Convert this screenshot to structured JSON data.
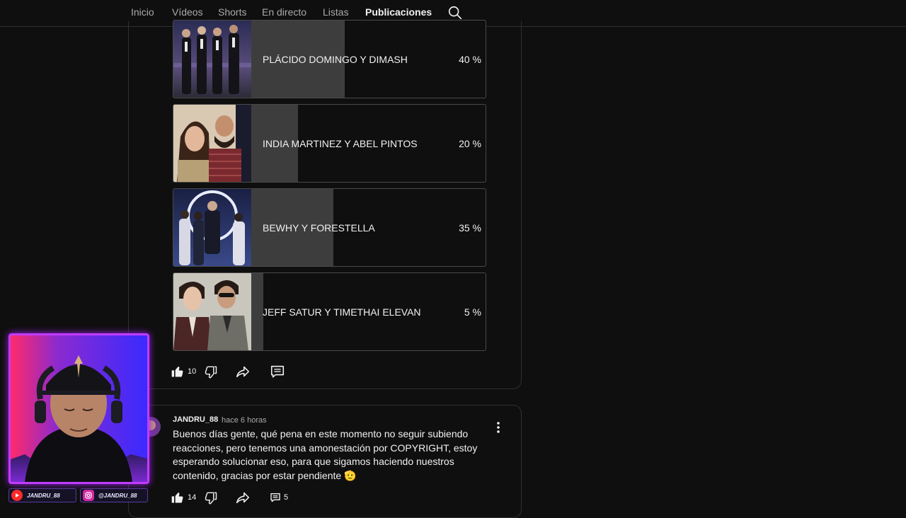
{
  "tabs": {
    "items": [
      "Inicio",
      "Vídeos",
      "Shorts",
      "En directo",
      "Listas",
      "Publicaciones"
    ],
    "active": "Publicaciones"
  },
  "poll": {
    "options": [
      {
        "label": "PLÁCIDO DOMINGO Y DIMASH",
        "percent": "40 %",
        "fraction": 0.4
      },
      {
        "label": "INDIA MARTINEZ Y ABEL PINTOS",
        "percent": "20 %",
        "fraction": 0.2
      },
      {
        "label": "BEWHY Y FORESTELLA",
        "percent": "35 %",
        "fraction": 0.35
      },
      {
        "label": "JEFF SATUR Y TIMETHAI ELEVAN",
        "percent": "5 %",
        "fraction": 0.05
      }
    ],
    "likes": "10"
  },
  "post": {
    "author": "JANDRU_88",
    "time": "hace 6 horas",
    "text": "Buenos días gente, qué pena en este momento no seguir subiendo reacciones, pero tenemos una amonestación por COPYRIGHT, estoy esperando solucionar eso, para que sigamos haciendo nuestros contenido, gracias por estar pendiente 🫡",
    "likes": "14",
    "comments": "5"
  },
  "overlay": {
    "youtube_handle": "JANDRU_88",
    "instagram_handle": "@JANDRU_88"
  },
  "colors": {
    "background": "#0f0f0f",
    "poll_fill": "#3d3d3d",
    "overlay_accent": "#c03cff"
  }
}
